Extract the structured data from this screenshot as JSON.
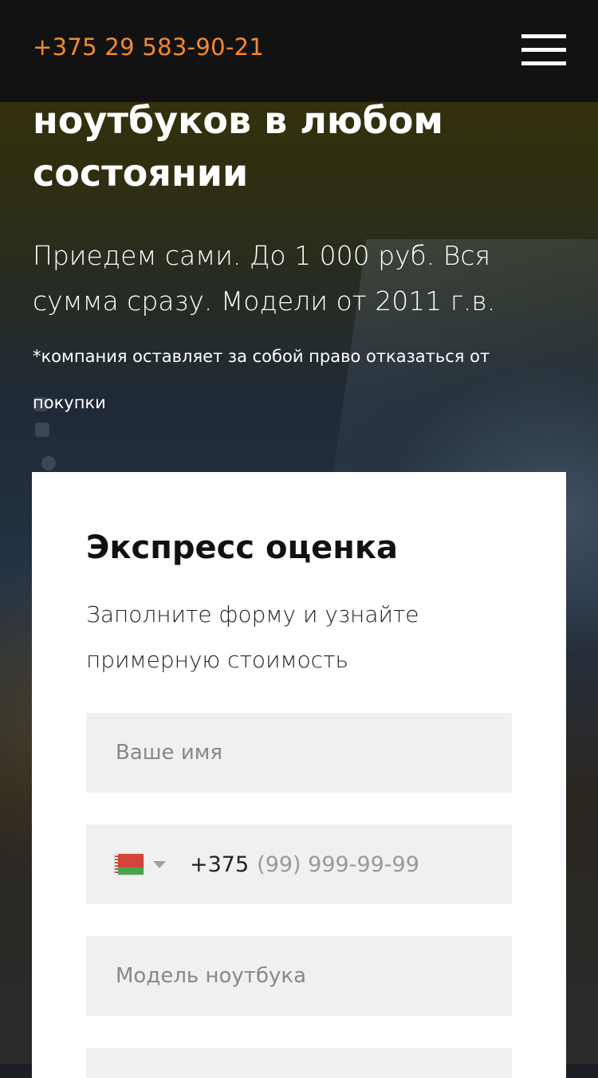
{
  "header": {
    "phone": "+375 29 583-90-21"
  },
  "hero": {
    "title_lines": [
      "ноутбуков в любом",
      "состоянии"
    ],
    "subtitle_lines": [
      "Приедем сами. До 1 000 руб. Вся",
      "сумма сразу. Модели от 2011 г.в."
    ],
    "note_lines": [
      "*компания оставляет за собой право отказаться от",
      "покупки"
    ]
  },
  "form": {
    "title": "Экспресс оценка",
    "subtitle_lines": [
      "Заполните форму и узнайте",
      "примерную стоимость"
    ],
    "name_placeholder": "Ваше имя",
    "phone_code": "+375",
    "phone_placeholder": "(99) 999-99-99",
    "model_placeholder": "Модель ноутбука",
    "country_flag": "belarus-flag"
  },
  "colors": {
    "accent": "#f5892c",
    "header_bg": "#121212",
    "field_bg": "#f0f0f0"
  }
}
